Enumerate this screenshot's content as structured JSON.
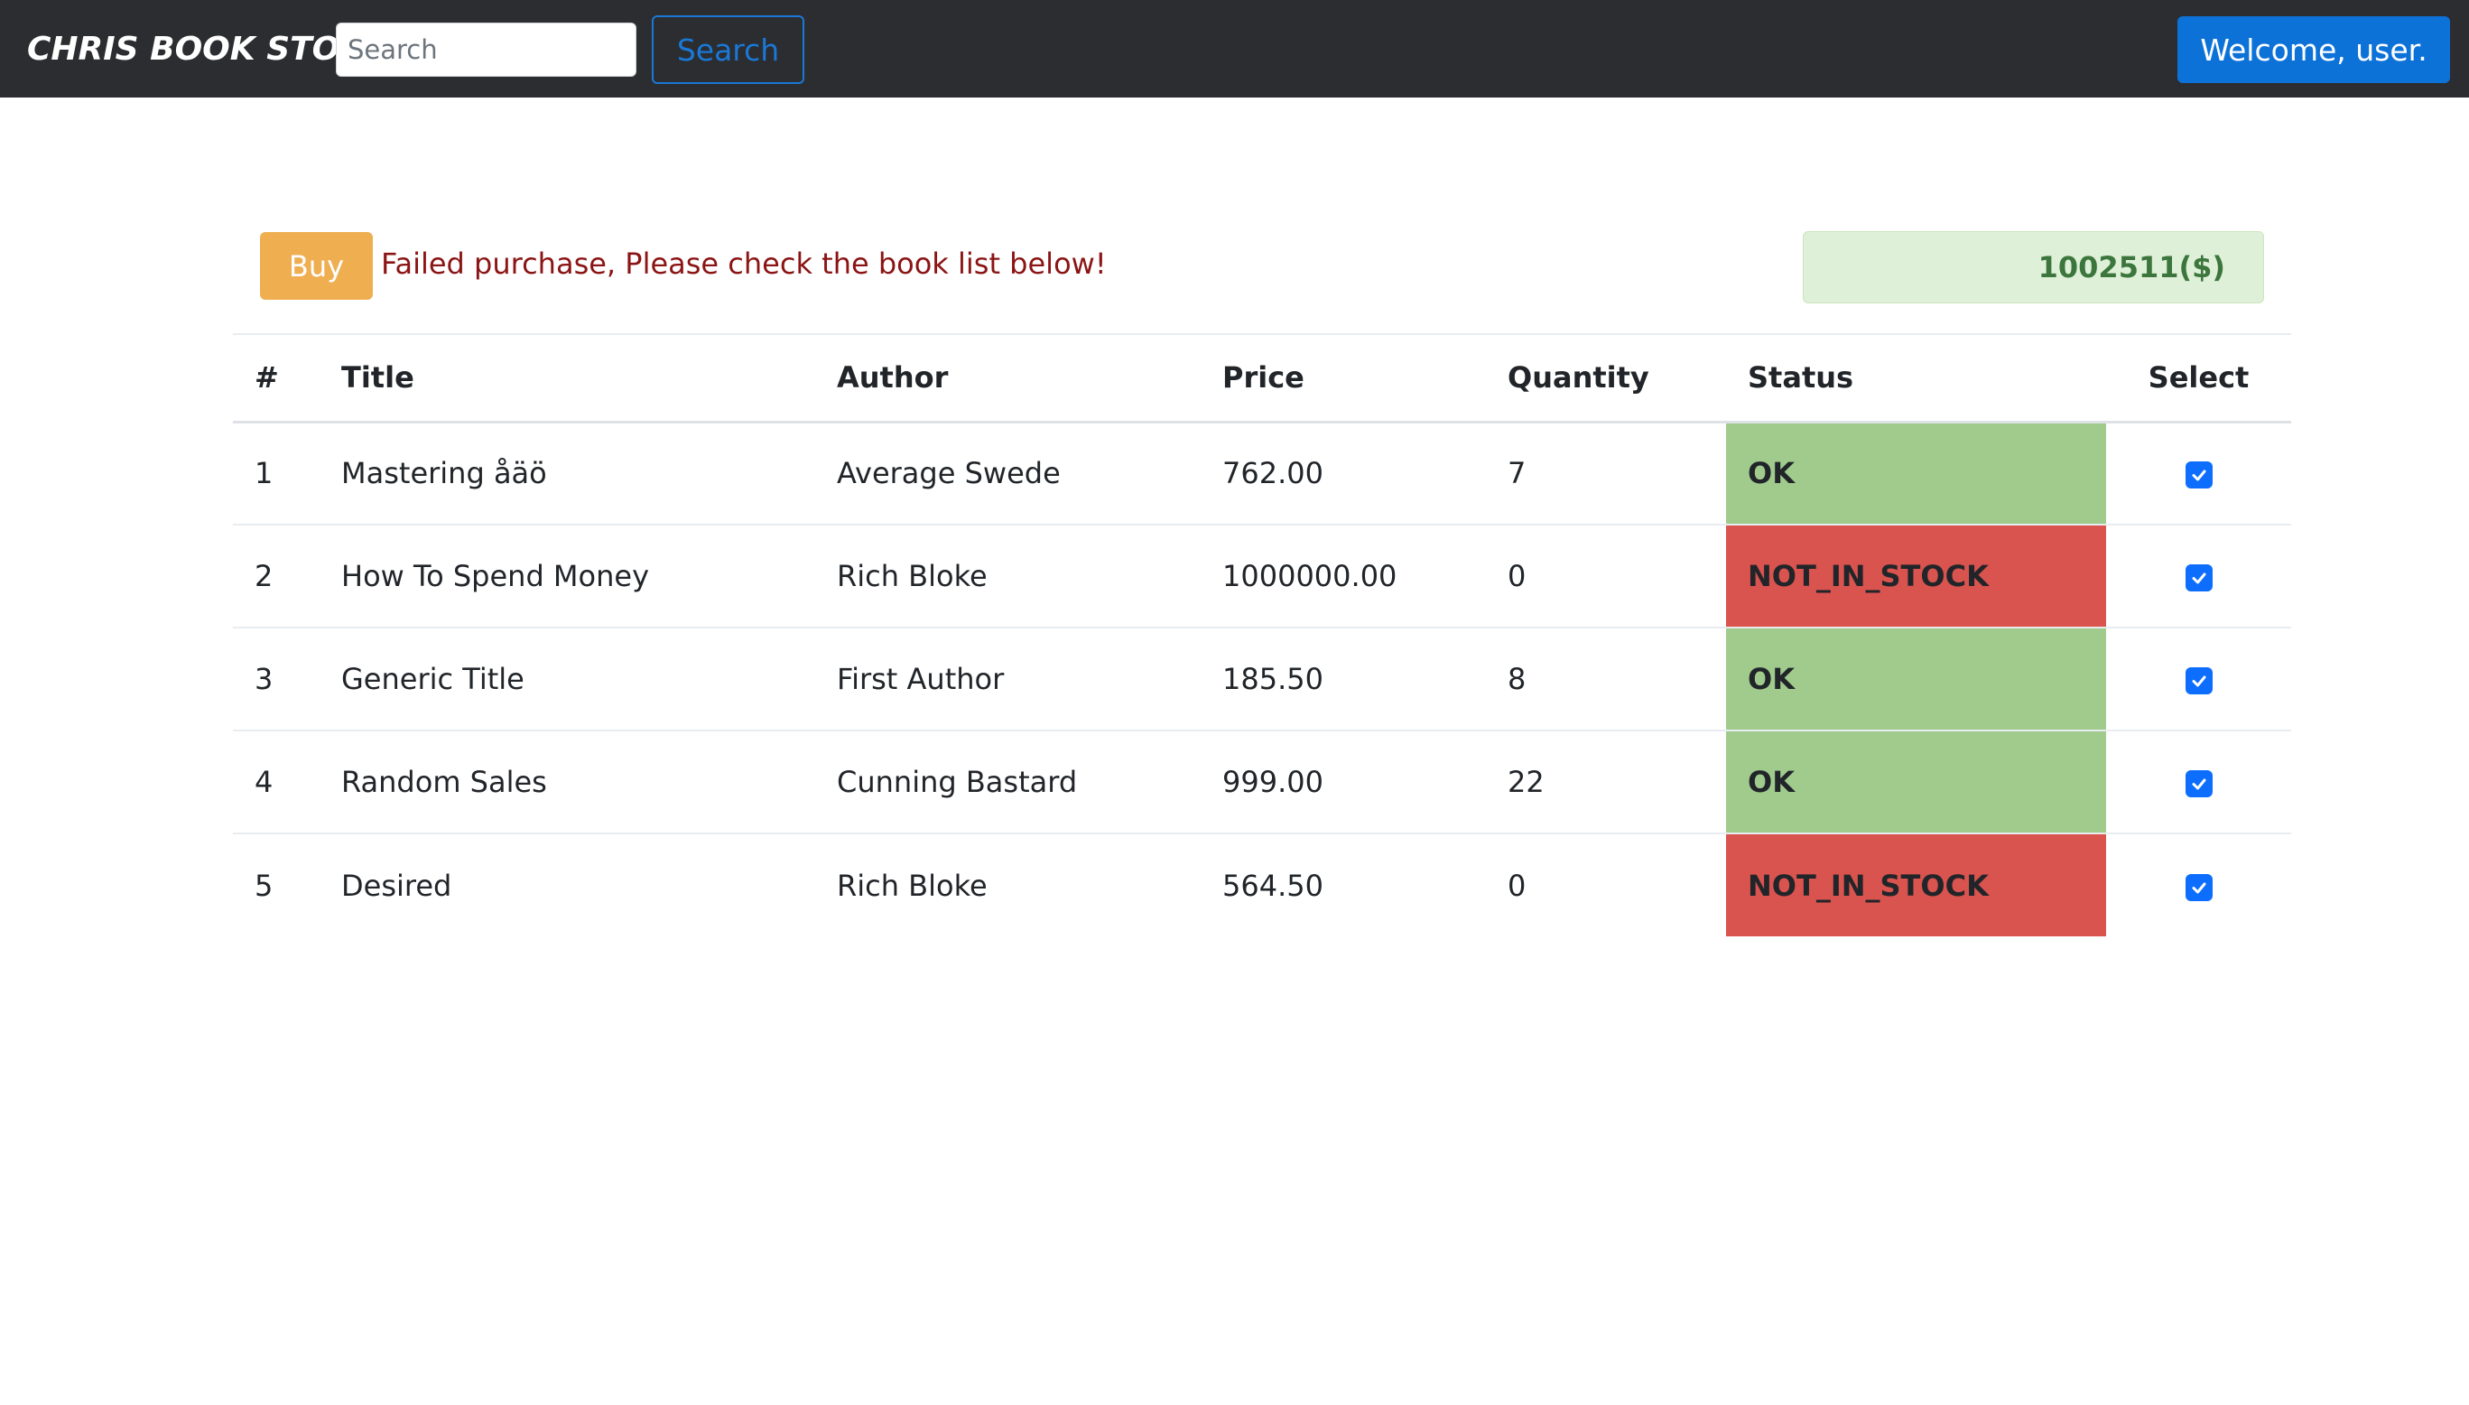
{
  "navbar": {
    "brand": "Chris Book Store",
    "search_placeholder": "Search",
    "search_value": "",
    "search_button": "Search",
    "welcome": "Welcome, user."
  },
  "actions": {
    "buy_label": "Buy",
    "message": "Failed purchase, Please check the book list below!",
    "balance": "1002511($)"
  },
  "table": {
    "headers": [
      "#",
      "Title",
      "Author",
      "Price",
      "Quantity",
      "Status",
      "Select"
    ],
    "rows": [
      {
        "num": "1",
        "title": "Mastering åäö",
        "author": "Average Swede",
        "price": "762.00",
        "quantity": "7",
        "status": "OK",
        "selected": true
      },
      {
        "num": "2",
        "title": "How To Spend Money",
        "author": "Rich Bloke",
        "price": "1000000.00",
        "quantity": "0",
        "status": "NOT_IN_STOCK",
        "selected": true
      },
      {
        "num": "3",
        "title": "Generic Title",
        "author": "First Author",
        "price": "185.50",
        "quantity": "8",
        "status": "OK",
        "selected": true
      },
      {
        "num": "4",
        "title": "Random Sales",
        "author": "Cunning Bastard",
        "price": "999.00",
        "quantity": "22",
        "status": "OK",
        "selected": true
      },
      {
        "num": "5",
        "title": "Desired",
        "author": "Rich Bloke",
        "price": "564.50",
        "quantity": "0",
        "status": "NOT_IN_STOCK",
        "selected": true
      }
    ]
  },
  "colors": {
    "navbar_bg": "#2b2d30",
    "primary": "#0d72d8",
    "warning": "#efae50",
    "status_ok": "#a0cb8d",
    "status_not_in_stock": "#d9534f",
    "error_text": "#8b1414",
    "balance_bg": "#dff0d8",
    "balance_text": "#3c763d"
  }
}
